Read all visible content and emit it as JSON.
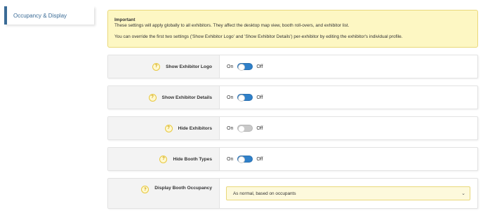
{
  "sidebar": {
    "active_tab": "Occupancy & Display"
  },
  "notice": {
    "title": "Important",
    "line1": "These settings will apply globally to all exhibitors. They affect the desktop map view, booth roll-overs, and exhibitor list.",
    "line2": "You can override the first two settings ('Show Exhibitor Logo' and 'Show Exhibitor Details') per-exhibitor by editing the exhibitor's individual profile."
  },
  "settings": [
    {
      "label": "Show Exhibitor Logo",
      "on": "On",
      "off": "Off",
      "enabled": true
    },
    {
      "label": "Show Exhibitor Details",
      "on": "On",
      "off": "Off",
      "enabled": true
    },
    {
      "label": "Hide Exhibitors",
      "on": "On",
      "off": "Off",
      "enabled": false
    },
    {
      "label": "Hide Booth Types",
      "on": "On",
      "off": "Off",
      "enabled": true
    }
  ],
  "occupancy": {
    "label": "Display Booth Occupancy",
    "selected": "As normal, based on occupants"
  },
  "help_glyph": "?"
}
